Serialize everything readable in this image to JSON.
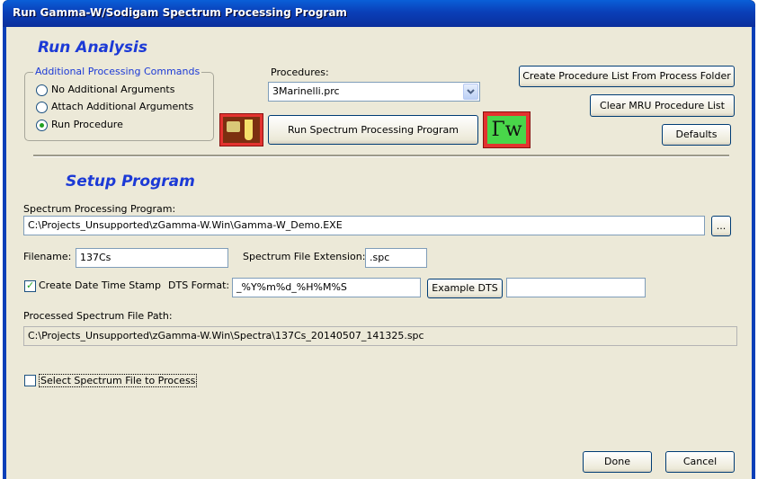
{
  "window": {
    "title": "Run Gamma-W/Sodigam Spectrum Processing Program"
  },
  "run_analysis": {
    "title": "Run Analysis",
    "group_label": "Additional Processing Commands",
    "options": [
      {
        "label": "No Additional Arguments",
        "checked": false
      },
      {
        "label": "Attach Additional Arguments",
        "checked": false
      },
      {
        "label": "Run Procedure",
        "checked": true
      }
    ],
    "procedures_label": "Procedures:",
    "procedures_value": "3Marinelli.prc",
    "run_button": "Run Spectrum Processing Program",
    "create_list_button": "Create Procedure List From Process Folder",
    "clear_mru_button": "Clear MRU Procedure List",
    "defaults_button": "Defaults",
    "gamma_w_logo_text": "Γw"
  },
  "setup": {
    "title": "Setup Program",
    "program_label": "Spectrum Processing Program:",
    "program_value": "C:\\Projects_Unsupported\\zGamma-W.Win\\Gamma-W_Demo.EXE",
    "browse_button": "...",
    "filename_label": "Filename:",
    "filename_value": "137Cs",
    "extension_label": "Spectrum File Extension:",
    "extension_value": ".spc",
    "dts_checkbox_label": "Create Date Time Stamp",
    "dts_checked": true,
    "dts_format_label": "DTS Format:",
    "dts_format_value": "_%Y%m%d_%H%M%S",
    "example_dts_button": "Example DTS",
    "example_dts_value": "",
    "path_label": "Processed Spectrum File Path:",
    "path_value": "C:\\Projects_Unsupported\\zGamma-W.Win\\Spectra\\137Cs_20140507_141325.spc",
    "select_file_label": "Select Spectrum File to Process",
    "select_file_checked": false
  },
  "footer": {
    "done_button": "Done",
    "cancel_button": "Cancel"
  }
}
